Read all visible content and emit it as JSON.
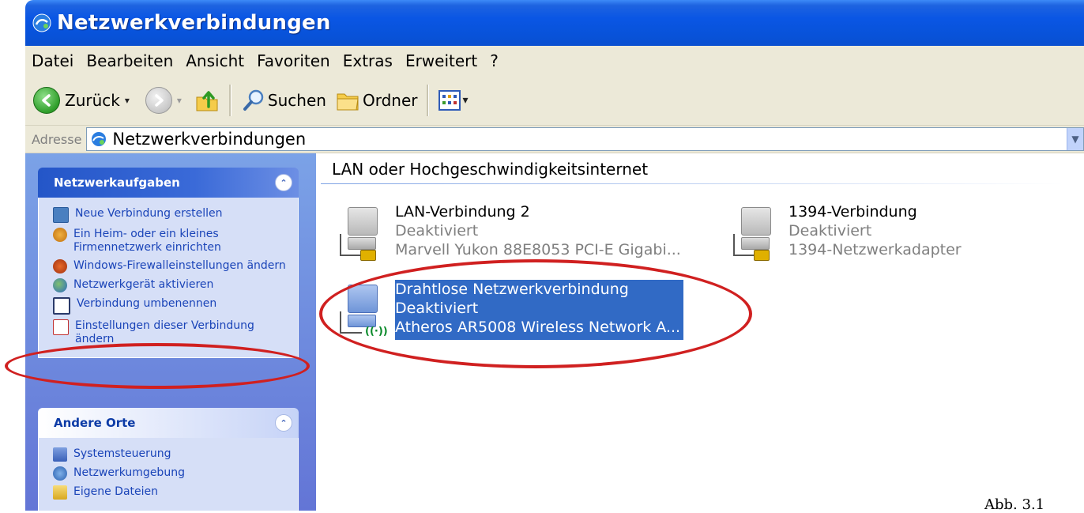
{
  "window": {
    "title": "Netzwerkverbindungen"
  },
  "menu": [
    "Datei",
    "Bearbeiten",
    "Ansicht",
    "Favoriten",
    "Extras",
    "Erweitert",
    "?"
  ],
  "toolbar": {
    "back_label": "Zurück",
    "search_label": "Suchen",
    "folders_label": "Ordner"
  },
  "address": {
    "label": "Adresse",
    "value": "Netzwerkverbindungen"
  },
  "sidebar": {
    "network_tasks": {
      "header": "Netzwerkaufgaben",
      "items": [
        "Neue Verbindung erstellen",
        "Ein Heim- oder ein kleines Firmennetzwerk einrichten",
        "Windows-Firewalleinstellungen ändern",
        "Netzwerkgerät aktivieren",
        "Verbindung umbenennen",
        "Einstellungen dieser Verbindung ändern"
      ]
    },
    "other_places": {
      "header": "Andere Orte",
      "items": [
        "Systemsteuerung",
        "Netzwerkumgebung",
        "Eigene Dateien"
      ]
    }
  },
  "main": {
    "group_title": "LAN oder Hochgeschwindigkeitsinternet",
    "connections": [
      {
        "name": "LAN-Verbindung 2",
        "status": "Deaktiviert",
        "device": "Marvell Yukon 88E8053 PCI-E Gigabi..."
      },
      {
        "name": "1394-Verbindung",
        "status": "Deaktiviert",
        "device": "1394-Netzwerkadapter"
      },
      {
        "name": "Drahtlose Netzwerkverbindung",
        "status": "Deaktiviert",
        "device": "Atheros AR5008 Wireless Network A..."
      }
    ]
  },
  "caption": "Abb. 3.1",
  "colors": {
    "titlebar": "#0a56e4",
    "selection": "#316ac5",
    "annotation": "#d02020",
    "sidebar": "#6f8ee0"
  }
}
